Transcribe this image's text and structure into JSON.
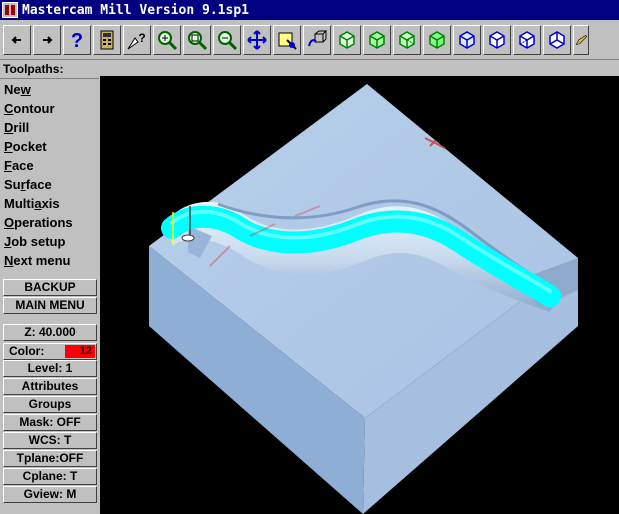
{
  "window": {
    "title": "Mastercam Mill Version 9.1sp1"
  },
  "toolbar": {
    "buttons": [
      {
        "icon": "arrow-left-icon"
      },
      {
        "icon": "arrow-right-icon"
      },
      {
        "icon": "help-icon"
      },
      {
        "icon": "calculator-icon"
      },
      {
        "icon": "analyze-icon"
      },
      {
        "icon": "zoom-icon"
      },
      {
        "icon": "unzoom-icon"
      },
      {
        "icon": "zoom-fit-icon"
      },
      {
        "icon": "pan-icon"
      },
      {
        "icon": "select-window-icon"
      },
      {
        "icon": "rotate-view-icon"
      },
      {
        "icon": "view-top-icon"
      },
      {
        "icon": "view-front-icon"
      },
      {
        "icon": "view-side-icon"
      },
      {
        "icon": "view-iso-icon"
      },
      {
        "icon": "cube-blue-1-icon"
      },
      {
        "icon": "cube-blue-2-icon"
      },
      {
        "icon": "cube-blue-3-icon"
      },
      {
        "icon": "cube-blue-4-icon"
      },
      {
        "icon": "pencil-icon"
      }
    ]
  },
  "sidebar": {
    "header": "Toolpaths:",
    "menu": [
      {
        "key": "N",
        "pre": "Ne",
        "rest": "w",
        "full": "New"
      },
      {
        "key": "C",
        "pre": "",
        "rest": "ontour",
        "full": "Contour"
      },
      {
        "key": "D",
        "pre": "",
        "rest": "rill",
        "full": "Drill"
      },
      {
        "key": "P",
        "pre": "",
        "rest": "ocket",
        "full": "Pocket"
      },
      {
        "key": "F",
        "pre": "",
        "rest": "ace",
        "full": "Face"
      },
      {
        "key": "r",
        "pre": "Su",
        "rest": "face",
        "full": "Surface"
      },
      {
        "key": "a",
        "pre": "Multi",
        "rest": "xis",
        "full": "Multiaxis"
      },
      {
        "key": "O",
        "pre": "",
        "rest": "perations",
        "full": "Operations"
      },
      {
        "key": "J",
        "pre": "",
        "rest": "ob setup",
        "full": "Job setup"
      },
      {
        "key": "N",
        "pre": "",
        "rest": "ext menu",
        "full": "Next menu"
      }
    ],
    "backup": "BACKUP",
    "main_menu": "MAIN MENU",
    "z": "Z:  40.000",
    "color_label": "Color:",
    "color_value": "12",
    "color_hex": "#ff0000",
    "level": "Level:  1",
    "attributes": "Attributes",
    "groups": "Groups",
    "mask": "Mask:  OFF",
    "wcs": "WCS:   T",
    "tplane": "Tplane:OFF",
    "cplane": "Cplane:  T",
    "gview": "Gview:   M"
  },
  "viewport": {
    "background": "#000000",
    "stock_color": "#b5cde8",
    "toolpath_color": "#00ffff"
  }
}
